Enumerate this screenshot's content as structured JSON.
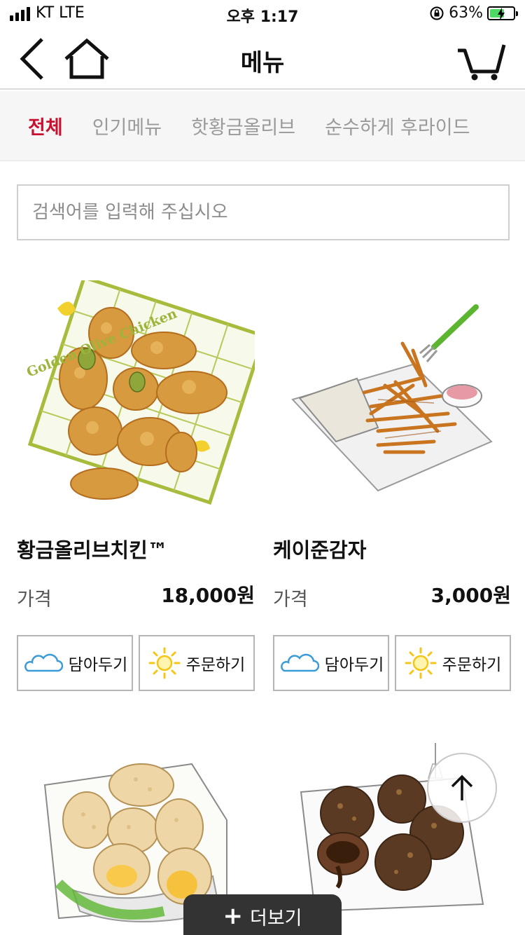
{
  "status_bar": {
    "carrier": "KT  LTE",
    "time": "오후 1:17",
    "battery": "63%",
    "battery_level": 0.63
  },
  "header": {
    "title": "메뉴"
  },
  "tabs": [
    {
      "label": "전체",
      "active": true
    },
    {
      "label": "인기메뉴",
      "active": false
    },
    {
      "label": "핫황금올리브",
      "active": false
    },
    {
      "label": "순수하게 후라이드",
      "active": false
    }
  ],
  "search": {
    "placeholder": "검색어를 입력해 주십시오"
  },
  "products": [
    {
      "name": "황금올리브치킨™",
      "price_label": "가격",
      "price": "18,000원",
      "image_text": "Golden Olive Chicken",
      "cart_label": "담아두기",
      "order_label": "주문하기"
    },
    {
      "name": "케이준감자",
      "price_label": "가격",
      "price": "3,000원",
      "cart_label": "담아두기",
      "order_label": "주문하기"
    },
    {
      "name": "",
      "price_label": "",
      "price": ""
    },
    {
      "name": "",
      "price_label": "",
      "price": ""
    }
  ],
  "more_button": {
    "label": "더보기"
  },
  "colors": {
    "accent": "#c8102e",
    "button_dark": "#333333",
    "battery_green": "#4cd964",
    "sun_yellow": "#f5c518",
    "cloud_blue": "#3b9bd8"
  }
}
